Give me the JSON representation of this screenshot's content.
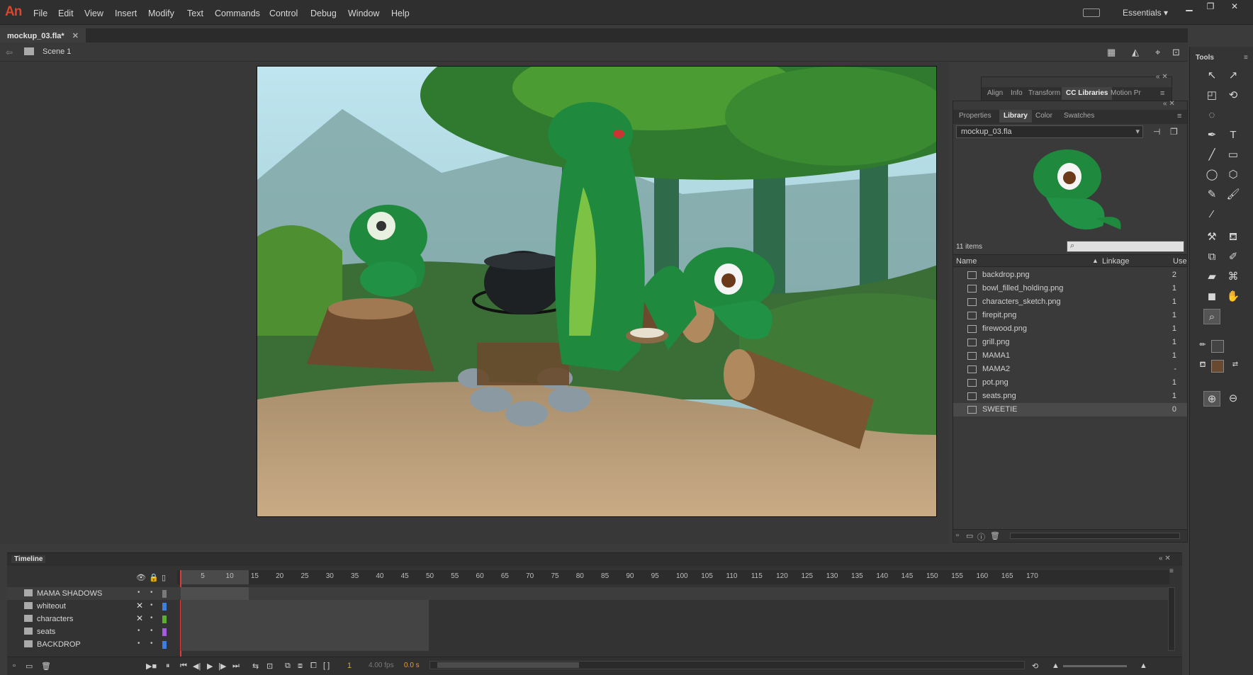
{
  "app": {
    "logo": "An",
    "workspace": "Essentials"
  },
  "menu": [
    "File",
    "Edit",
    "View",
    "Insert",
    "Modify",
    "Text",
    "Commands",
    "Control",
    "Debug",
    "Window",
    "Help"
  ],
  "document": {
    "tab_label": "mockup_03.fla*",
    "scene": "Scene 1"
  },
  "top_panel": {
    "tabs": [
      "Align",
      "Info",
      "Transform",
      "CC Libraries",
      "Motion Pr"
    ]
  },
  "library_panel": {
    "tabs": [
      "Properties",
      "Library",
      "Color",
      "Swatches"
    ],
    "active_tab": "Library",
    "document_select": "mockup_03.fla",
    "item_count": "11 items",
    "columns": {
      "name": "Name",
      "linkage": "Linkage",
      "use": "Use"
    },
    "items": [
      {
        "name": "backdrop.png",
        "use": "2"
      },
      {
        "name": "bowl_filled_holding.png",
        "use": "1"
      },
      {
        "name": "characters_sketch.png",
        "use": "1"
      },
      {
        "name": "firepit.png",
        "use": "1"
      },
      {
        "name": "firewood.png",
        "use": "1"
      },
      {
        "name": "grill.png",
        "use": "1"
      },
      {
        "name": "MAMA1",
        "use": "1"
      },
      {
        "name": "MAMA2",
        "use": "-"
      },
      {
        "name": "pot.png",
        "use": "1"
      },
      {
        "name": "seats.png",
        "use": "1"
      },
      {
        "name": "SWEETIE",
        "use": "0"
      }
    ]
  },
  "tools": {
    "title": "Tools"
  },
  "timeline": {
    "title": "Timeline",
    "frame_numbers": [
      "5",
      "10",
      "15",
      "20",
      "25",
      "30",
      "35",
      "40",
      "45",
      "50",
      "55",
      "60",
      "65",
      "70",
      "75",
      "80",
      "85",
      "90",
      "95",
      "100",
      "105",
      "110",
      "115",
      "120",
      "125",
      "130",
      "135",
      "140",
      "145",
      "150",
      "155",
      "160",
      "165",
      "170"
    ],
    "layers": [
      {
        "name": "MAMA SHADOWS",
        "color": "#7a7a7a"
      },
      {
        "name": "whiteout",
        "color": "#3d7fe0"
      },
      {
        "name": "characters",
        "color": "#58b02c"
      },
      {
        "name": "seats",
        "color": "#a45de0"
      },
      {
        "name": "BACKDROP",
        "color": "#3d7fe0"
      }
    ],
    "current_frame": "1",
    "fps": "4.00 fps",
    "time": "0.0 s"
  },
  "colors": {
    "accent": "#d9452b",
    "playhead": "#e03a3a"
  }
}
